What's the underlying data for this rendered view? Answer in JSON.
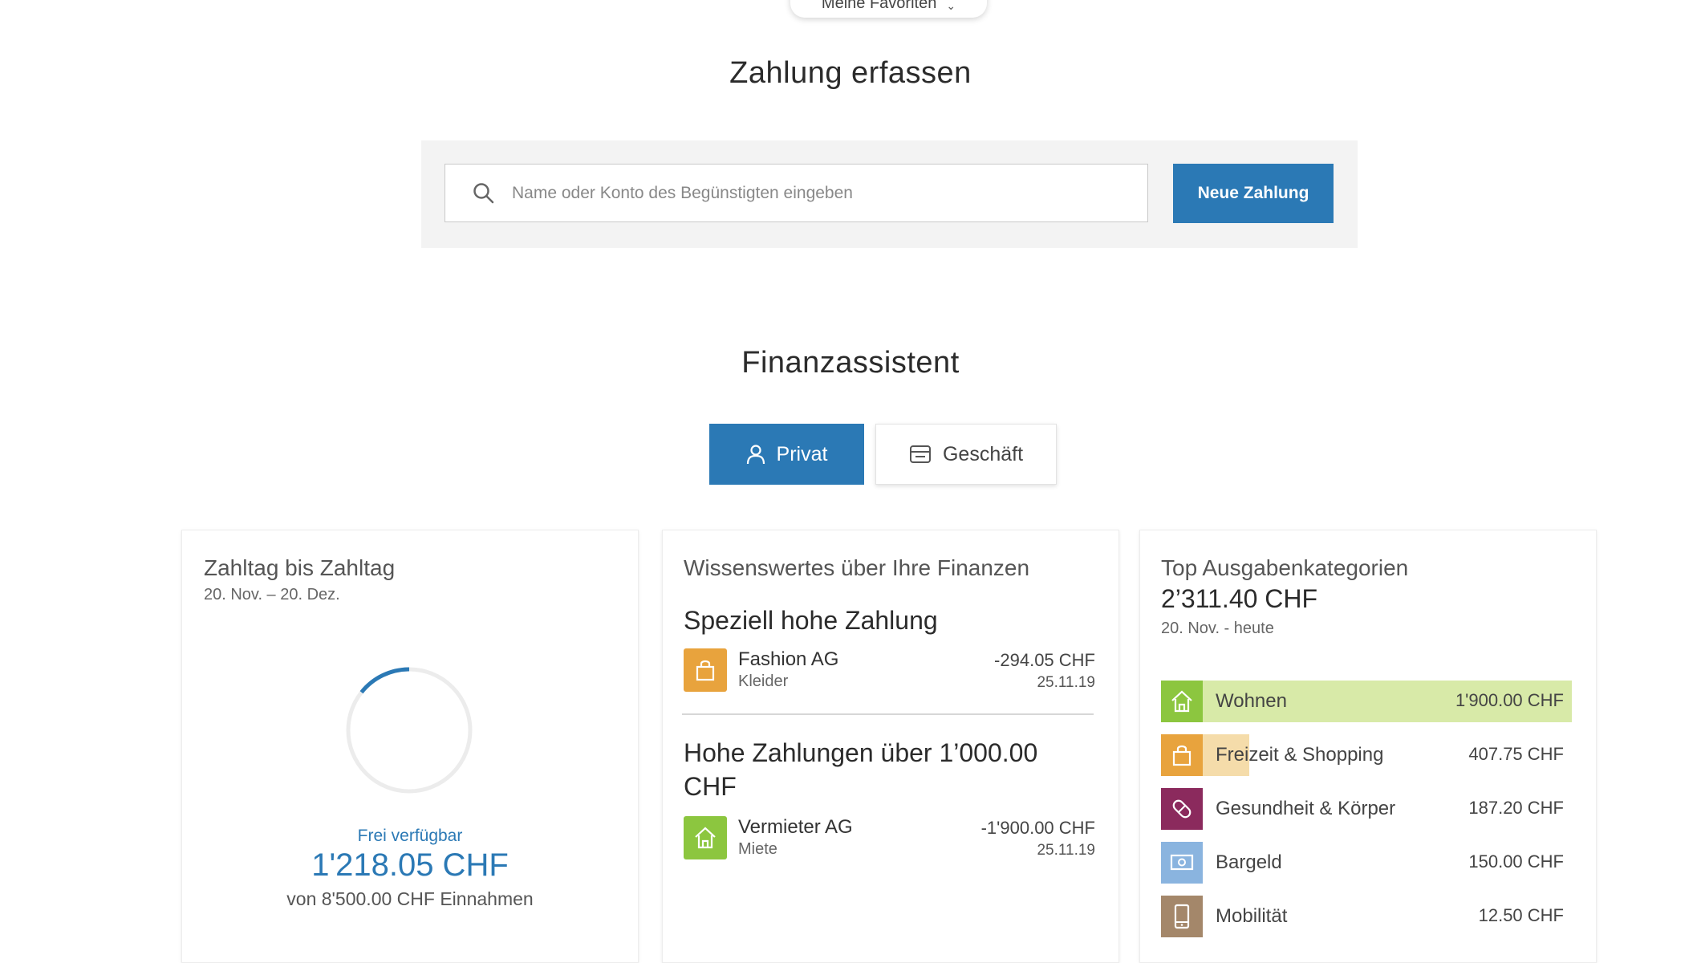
{
  "header": {
    "favorites_label": "Meine Favoriten"
  },
  "payment": {
    "title": "Zahlung erfassen",
    "search_placeholder": "Name oder Konto des Begünstigten eingeben",
    "search_value": "",
    "new_payment_button": "Neue Zahlung"
  },
  "assistant": {
    "title": "Finanzassistent",
    "toggle": {
      "private_label": "Privat",
      "business_label": "Geschäft",
      "active": "Privat"
    }
  },
  "payday_card": {
    "title": "Zahltag bis Zahltag",
    "period": "20. Nov. – 20. Dez.",
    "free_label": "Frei verfügbar",
    "free_amount": "1'218.05 CHF",
    "income_text": "von 8'500.00 CHF Einnahmen",
    "available_fraction": 0.143
  },
  "insights_card": {
    "title": "Wissenswertes über Ihre Finanzen",
    "section1_title": "Speziell hohe Zahlung",
    "tx1": {
      "name": "Fashion AG",
      "category": "Kleider",
      "amount": "-294.05 CHF",
      "date": "25.11.19",
      "icon": "shopping-bag-icon"
    },
    "section2_title": "Hohe Zahlungen über 1’000.00 CHF",
    "tx2": {
      "name": "Vermieter AG",
      "category": "Miete",
      "amount": "-1'900.00 CHF",
      "date": "25.11.19",
      "icon": "house-icon"
    }
  },
  "categories_card": {
    "title": "Top Ausgabenkategorien",
    "total": "2’311.40 CHF",
    "period": "20. Nov. - heute",
    "items": [
      {
        "label": "Wohnen",
        "value": "1'900.00 CHF",
        "color": "#8cc63f",
        "bar_color": "#d8eaa8",
        "share": 1.0,
        "icon": "house-icon"
      },
      {
        "label": "Freizeit & Shopping",
        "value": "407.75 CHF",
        "color": "#e8a33d",
        "bar_color": "#f5dcaa",
        "share": 0.215,
        "icon": "shopping-bag-icon"
      },
      {
        "label": "Gesundheit & Körper",
        "value": "187.20 CHF",
        "color": "#8b2a5d",
        "bar_color": "#d9b3c9",
        "share": 0.099,
        "icon": "bandage-icon"
      },
      {
        "label": "Bargeld",
        "value": "150.00 CHF",
        "color": "#8ab4df",
        "bar_color": "#d7e6f4",
        "share": 0.079,
        "icon": "banknote-icon"
      },
      {
        "label": "Mobilität",
        "value": "12.50 CHF",
        "color": "#a4876a",
        "bar_color": "#e6dccf",
        "share": 0.007,
        "icon": "phone-icon"
      }
    ]
  }
}
